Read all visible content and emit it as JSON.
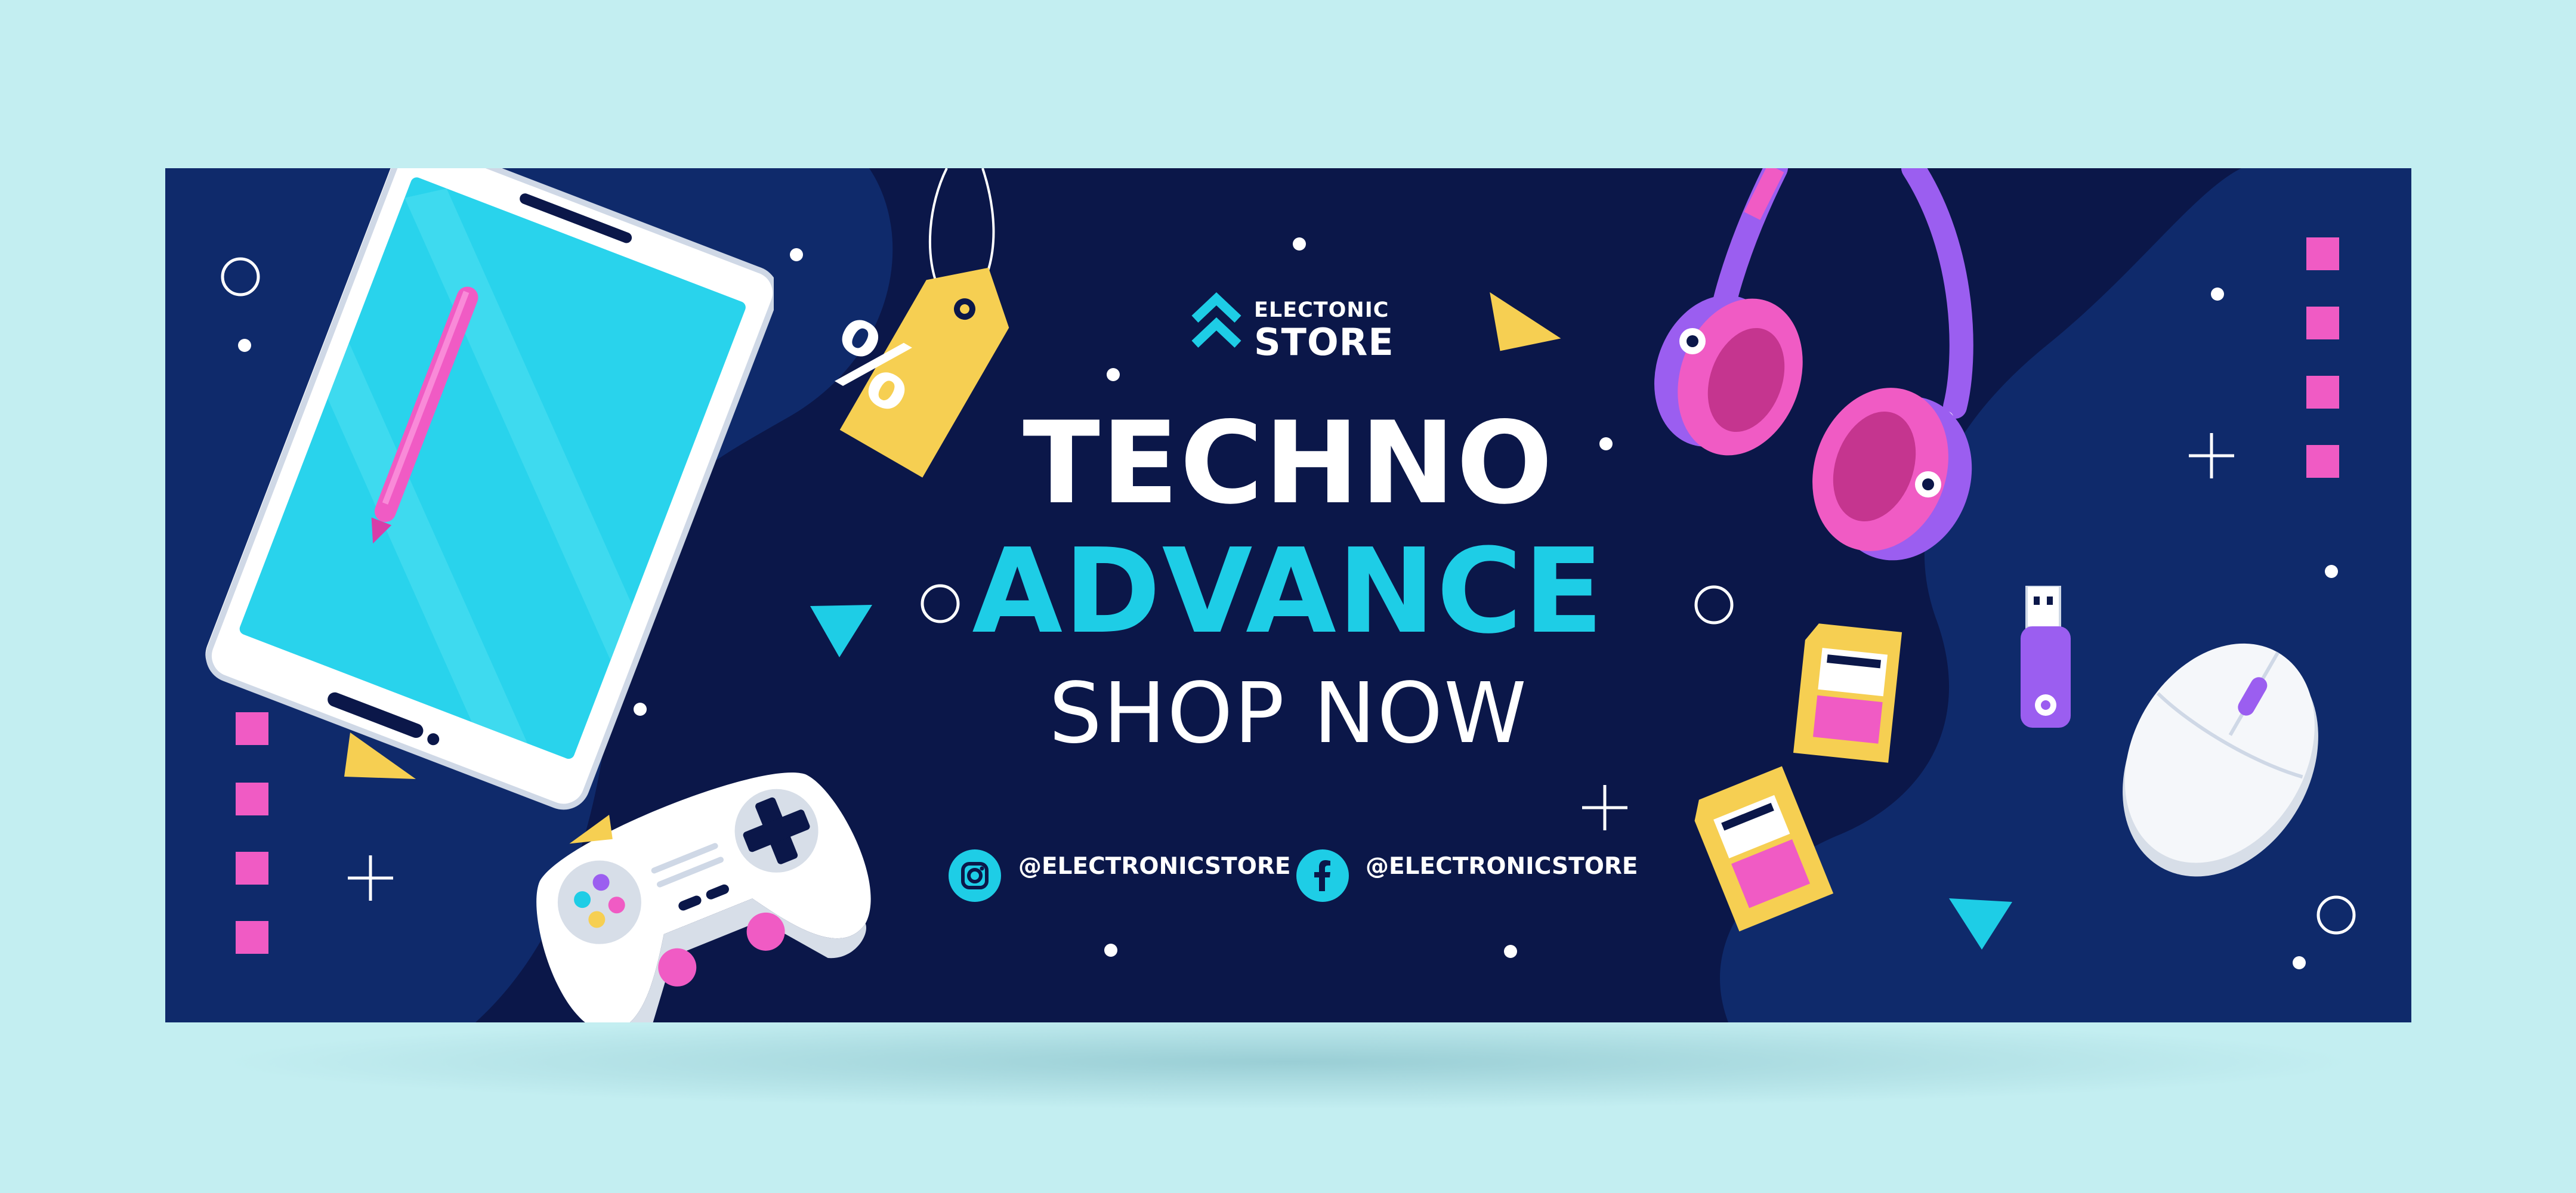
{
  "brand": {
    "line1": "ELECTONIC",
    "line2": "STORE",
    "icon": "double-chevron-up-icon"
  },
  "headline": {
    "line1": "TECHNO",
    "line2": "ADVANCE",
    "cta": "SHOP NOW"
  },
  "social": [
    {
      "network": "instagram",
      "icon": "instagram-icon",
      "handle": "@ELECTRONICSTORE"
    },
    {
      "network": "facebook",
      "icon": "facebook-icon",
      "handle": "@ELECTRONICSTORE"
    }
  ],
  "price_tag_symbol": "%",
  "colors": {
    "background": "#c3eef1",
    "banner": "#0b1749",
    "blob": "#0f2a6b",
    "accent_cyan": "#1ecde6",
    "accent_pink": "#f05bc4",
    "accent_yellow": "#f6cf52",
    "accent_purple": "#9b5ef0",
    "text": "#ffffff"
  }
}
